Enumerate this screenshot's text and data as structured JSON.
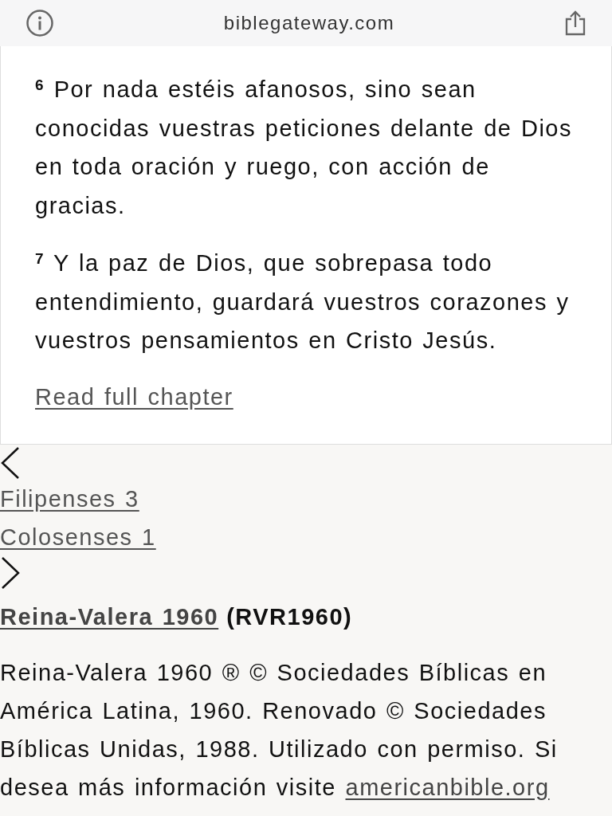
{
  "address_bar": {
    "url": "biblegateway.com"
  },
  "passage": {
    "verses": [
      {
        "number": "6",
        "text": "Por nada estéis afanosos, sino sean conocidas vuestras peticiones delante de Dios en toda oración y ruego, con acción de gracias."
      },
      {
        "number": "7",
        "text": "Y la paz de Dios, que sobrepasa todo entendimiento, guardará vuestros corazones y vuestros pensamientos en Cristo Jesús."
      }
    ],
    "read_full_chapter": "Read full chapter"
  },
  "chapter_nav": {
    "previous": "Filipenses 3",
    "next": "Colosenses 1"
  },
  "version": {
    "name": "Reina-Valera 1960",
    "abbreviation": "(RVR1960)",
    "copyright": "Reina-Valera 1960 ® © Sociedades Bíblicas en América Latina, 1960. Renovado © Sociedades Bíblicas Unidas, 1988. Utilizado con permiso. Si desea más información visite",
    "copyright_link": "americanbible.org"
  }
}
